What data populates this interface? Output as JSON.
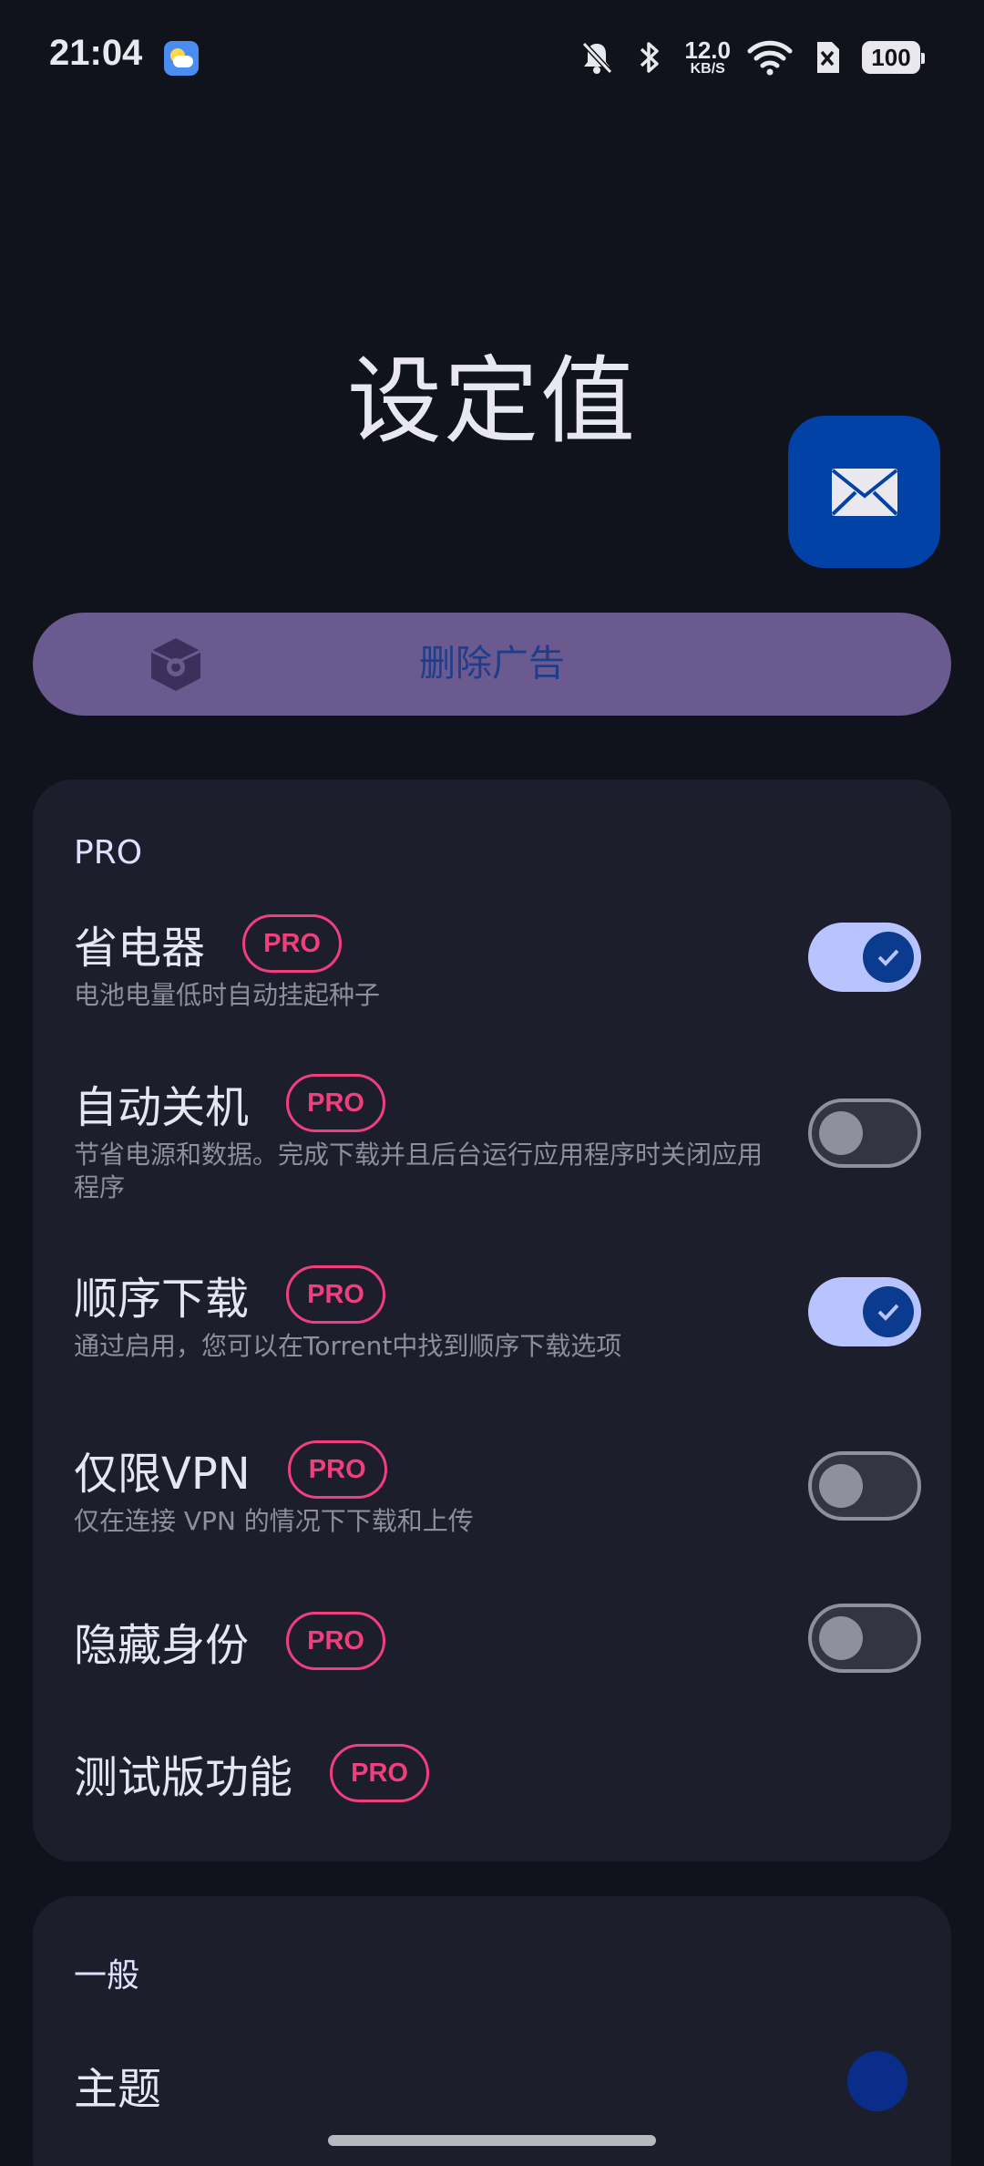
{
  "status_bar": {
    "time": "21:04",
    "net_speed_value": "12.0",
    "net_speed_unit": "KB/S",
    "battery": "100",
    "icons": [
      "weather-icon",
      "bell-off-icon",
      "bluetooth-icon",
      "wifi-icon",
      "sim-off-icon",
      "battery-icon"
    ]
  },
  "page": {
    "title": "设定值",
    "mail_button_icon": "mail-icon"
  },
  "remove_ads": {
    "label": "删除广告",
    "icon": "box-icon"
  },
  "pro_section": {
    "title": "PRO",
    "badge": "PRO",
    "items": [
      {
        "title": "省电器",
        "subtitle": "电池电量低时自动挂起种子",
        "toggle": true
      },
      {
        "title": "自动关机",
        "subtitle": "节省电源和数据。完成下载并且后台运行应用程序时关闭应用程序",
        "toggle": false
      },
      {
        "title": "顺序下载",
        "subtitle": "通过启用，您可以在Torrent中找到顺序下载选项",
        "toggle": true
      },
      {
        "title": "仅限VPN",
        "subtitle": "仅在连接 VPN 的情况下下载和上传",
        "toggle": false
      },
      {
        "title": "隐藏身份",
        "subtitle": "",
        "toggle": false
      },
      {
        "title": "测试版功能",
        "subtitle": ""
      }
    ]
  },
  "general_section": {
    "title": "一般",
    "items": [
      {
        "title": "主题",
        "color": "#0a2d8a"
      }
    ]
  },
  "colors": {
    "background": "#11131c",
    "card": "#1c1e2b",
    "accent": "#b8c4ff",
    "pro_pink": "#ef3f7d",
    "fab": "#0242a6",
    "remove_ads_bg": "#6b5a8f"
  }
}
